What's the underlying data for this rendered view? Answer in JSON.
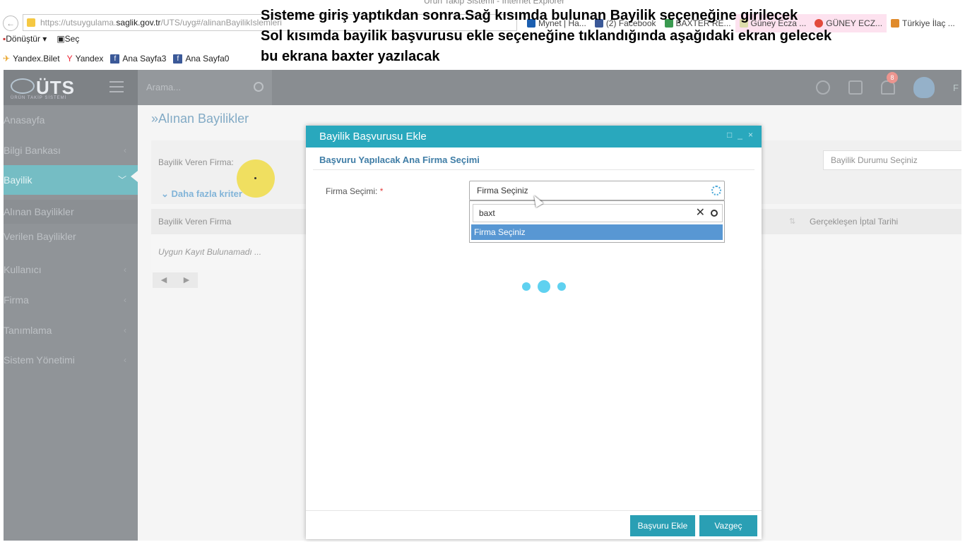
{
  "browser": {
    "title_fragment": "Ürün Takip Sistemi - Internet Explorer",
    "url_prefix": "https://utsuygulama.",
    "url_host": "saglik.gov.tr",
    "url_path": "/UTS/uyg#/alinanBayilikIslemleri",
    "tabs": [
      {
        "label": "Mynet | Ha...",
        "color": "#1b5fb0"
      },
      {
        "label": "(2) Facebook",
        "color": "#3b5998"
      },
      {
        "label": "BAXTER RE...",
        "color": "#3a9a50"
      },
      {
        "label": "Güney Ecza ...",
        "color": "#d9a"
      },
      {
        "label": "GÜNEY ECZ...",
        "color": "#e24a3b"
      },
      {
        "label": "Türkiye İlaç ...",
        "color": "#e08a2a"
      }
    ],
    "commands": {
      "convert": "Dönüştür",
      "select": "Seç"
    },
    "favorites": [
      "Yandex.Bilet",
      "Yandex",
      "Ana Sayfa3",
      "Ana Sayfa0"
    ]
  },
  "annotation": {
    "line1": "Sisteme giriş yaptıkdan sonra.Sağ kısımda bulunan Bayilik seçeneğine girilecek",
    "line2": "Sol kısımda bayilik başvurusu ekle seçeneğine tıklandığında aşağıdaki ekran gelecek",
    "line3": "bu ekrana baxter yazılacak"
  },
  "app": {
    "logo": "ÜTS",
    "logo_sub": "ÜRÜN TAKİP SİSTEMİ",
    "search_placeholder": "Arama...",
    "notification_count": "8",
    "user_initial": "F",
    "sidebar": {
      "items": [
        {
          "label": "Anasayfa"
        },
        {
          "label": "Bilgi Bankası"
        },
        {
          "label": "Bayilik"
        },
        {
          "label": "Kullanıcı"
        },
        {
          "label": "Firma"
        },
        {
          "label": "Tanımlama"
        },
        {
          "label": "Sistem Yönetimi"
        }
      ],
      "sub_items": [
        {
          "label": "Alınan Bayilikler"
        },
        {
          "label": "Verilen Bayilikler"
        }
      ]
    },
    "page_title": "»Alınan Bayilikler",
    "filter": {
      "label": "Bayilik Veren Firma:",
      "more_criteria": "Daha fazla kriter",
      "status_select": "Bayilik Durumu Seçiniz"
    },
    "table": {
      "columns": [
        "Bayilik Veren Firma",
        "Gerçekleşen İptal Tarihi"
      ],
      "empty_message": "Uygun Kayıt Bulunamadı ..."
    }
  },
  "modal": {
    "title": "Bayilik Başvurusu Ekle",
    "subtitle": "Başvuru Yapılacak Ana Firma Seçimi",
    "field_label": "Firma Seçimi:",
    "required_mark": "*",
    "select_value": "Firma Seçiniz",
    "search_value": "baxt",
    "options": [
      "Firma Seçiniz"
    ],
    "buttons": {
      "submit": "Başvuru Ekle",
      "cancel": "Vazgeç"
    }
  }
}
